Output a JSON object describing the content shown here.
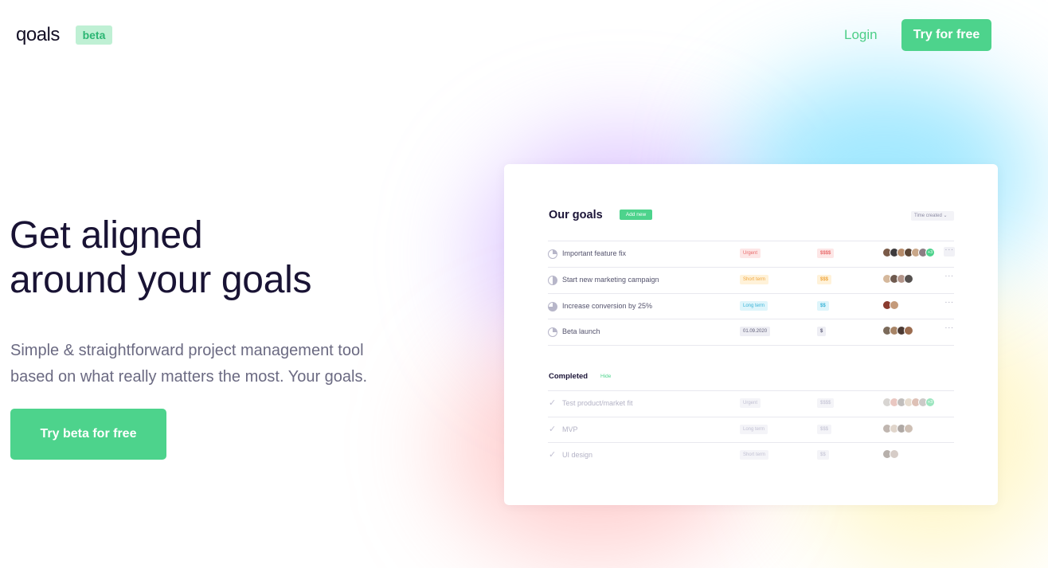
{
  "header": {
    "logo": "qoals",
    "badge": "beta",
    "login": "Login",
    "cta": "Try for free"
  },
  "hero": {
    "title_line1": "Get aligned",
    "title_line2": "around your goals",
    "subtitle_line1": "Simple & straightforward project management tool",
    "subtitle_line2": "based on what really matters the most. Your goals.",
    "cta": "Try beta for free"
  },
  "colors": {
    "accent": "#4dd38c",
    "title": "#191334",
    "muted": "#6b6a82"
  },
  "card": {
    "title": "Our goals",
    "add_new": "Add new",
    "sort": "Time created ⌄",
    "goals": [
      {
        "name": "Important feature fix",
        "tag": "Urgent",
        "money": "$$$$",
        "progress": 0.25,
        "extra_avatars": "+3"
      },
      {
        "name": "Start new marketing campaign",
        "tag": "Short term",
        "money": "$$$",
        "progress": 0.5
      },
      {
        "name": "Increase conversion by 25%",
        "tag": "Long term",
        "money": "$$",
        "progress": 0.75
      },
      {
        "name": "Beta launch",
        "tag": "01.09.2020",
        "money": "$",
        "progress": 0.25
      }
    ],
    "completed_title": "Completed",
    "hide": "Hide",
    "completed": [
      {
        "name": "Test product/market fit",
        "tag": "Urgent",
        "money": "$$$$",
        "extra_avatars": "+3"
      },
      {
        "name": "MVP",
        "tag": "Long term",
        "money": "$$$"
      },
      {
        "name": "UI design",
        "tag": "Short term",
        "money": "$$"
      }
    ]
  }
}
